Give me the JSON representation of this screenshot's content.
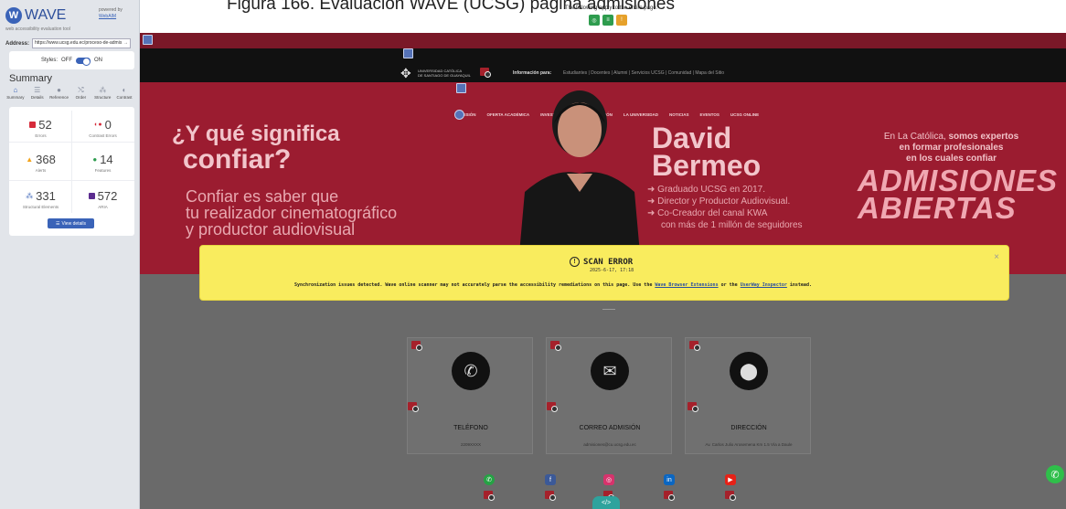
{
  "caption": "Figura 166. Evaluación WAVE (UCSG) página admisiones",
  "apply_note": "The following apply to the entire page:",
  "wave": {
    "logo": "WAVE",
    "logo_sub": "web accessibility evaluation tool",
    "powered_by": "powered by",
    "powered_link": "WebAIM",
    "address_label": "Address:",
    "address_value": "https://www.ucsg.edu.ec/proceso-de-admis",
    "styles_label": "Styles:",
    "styles_off": "OFF",
    "styles_on": "ON",
    "summary_heading": "Summary",
    "tabs": [
      "Summary",
      "Details",
      "Reference",
      "Order",
      "Structure",
      "Contrast"
    ],
    "stats": {
      "errors": {
        "value": "52",
        "label": "Errors",
        "color": "#d62b3a"
      },
      "contrast": {
        "value": "0",
        "label": "Contrast Errors",
        "color": "#d62b3a"
      },
      "alerts": {
        "value": "368",
        "label": "Alerts",
        "color": "#f2a31b"
      },
      "features": {
        "value": "14",
        "label": "Features",
        "color": "#2e9c4e"
      },
      "structural": {
        "value": "331",
        "label": "Structural Elements",
        "color": "#3a63b8"
      },
      "aria": {
        "value": "572",
        "label": "ARIA",
        "color": "#5b2c8f"
      }
    },
    "view_details": "View details"
  },
  "site": {
    "info_para": "Información para:",
    "info_links": "Estudiantes  |  Docentes  |  Alumni  |  Servicios UCSG  |  Comunidad  |  Mapa del Sitio",
    "nav": [
      "ADMISIÓN",
      "OFERTA ACADÉMICA",
      "INVESTIGACIÓN",
      "VINCULACIÓN",
      "LA UNIVERSIDAD",
      "NOTICIAS",
      "EVENTOS",
      "UCSG ONLINE"
    ],
    "hero_question": "¿Y qué significa",
    "hero_confiar": "confiar?",
    "hero_sub": [
      "Confiar es saber que",
      "tu realizador cinematográfico",
      "y productor audiovisual"
    ],
    "hero_name": [
      "David",
      "Bermeo"
    ],
    "hero_bullets": [
      "Graduado UCSG en 2017.",
      "Director y Productor Audiovisual.",
      "Co-Creador del canal KWA",
      "con más de 1 millón de seguidores"
    ],
    "right_blurb_1": "En La Católica, ",
    "right_blurb_strong": "somos expertos",
    "right_blurb_2": "en formar profesionales",
    "right_blurb_3": "en los cuales confiar",
    "admisiones": [
      "ADMISIONES",
      "ABIERTAS"
    ],
    "contact_cards": [
      {
        "title": "TELÉFONO",
        "value": "2209XXXX"
      },
      {
        "title": "CORREO ADMISIÓN",
        "value": "admisiones@cu.ucsg.edu.ec"
      },
      {
        "title": "DIRECCIÓN",
        "value": "Av. Carlos Julio Arosemena Km 1.5 Vía a Daule"
      }
    ]
  },
  "scan_error": {
    "title": "SCAN ERROR",
    "date": "2025-6-17, 17:18",
    "message_1": "Synchronization issues detected. Wave online scanner may not accurately parse the accessibility remediations on this page. Use the ",
    "link_1": "Wave Browser Extensions",
    "message_2": " or the ",
    "link_2": "UserWay Inspector",
    "message_3": " instead.",
    "close": "×"
  },
  "code_tab": "</>"
}
